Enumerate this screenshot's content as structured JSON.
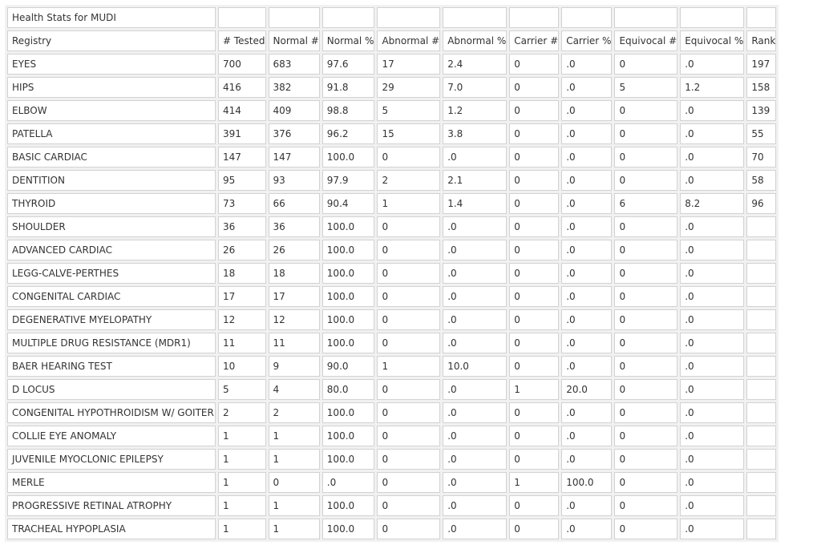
{
  "table": {
    "title": "Health Stats for MUDI",
    "headers": [
      "Registry",
      "# Tested",
      "Normal #",
      "Normal %",
      "Abnormal #",
      "Abnormal %",
      "Carrier #",
      "Carrier %",
      "Equivocal #",
      "Equivocal %",
      "Rank"
    ],
    "rows": [
      [
        "EYES",
        "700",
        "683",
        "97.6",
        "17",
        "2.4",
        "0",
        ".0",
        "0",
        ".0",
        "197"
      ],
      [
        "HIPS",
        "416",
        "382",
        "91.8",
        "29",
        "7.0",
        "0",
        ".0",
        "5",
        "1.2",
        "158"
      ],
      [
        "ELBOW",
        "414",
        "409",
        "98.8",
        "5",
        "1.2",
        "0",
        ".0",
        "0",
        ".0",
        "139"
      ],
      [
        "PATELLA",
        "391",
        "376",
        "96.2",
        "15",
        "3.8",
        "0",
        ".0",
        "0",
        ".0",
        "55"
      ],
      [
        "BASIC CARDIAC",
        "147",
        "147",
        "100.0",
        "0",
        ".0",
        "0",
        ".0",
        "0",
        ".0",
        "70"
      ],
      [
        "DENTITION",
        "95",
        "93",
        "97.9",
        "2",
        "2.1",
        "0",
        ".0",
        "0",
        ".0",
        "58"
      ],
      [
        "THYROID",
        "73",
        "66",
        "90.4",
        "1",
        "1.4",
        "0",
        ".0",
        "6",
        "8.2",
        "96"
      ],
      [
        "SHOULDER",
        "36",
        "36",
        "100.0",
        "0",
        ".0",
        "0",
        ".0",
        "0",
        ".0",
        ""
      ],
      [
        "ADVANCED CARDIAC",
        "26",
        "26",
        "100.0",
        "0",
        ".0",
        "0",
        ".0",
        "0",
        ".0",
        ""
      ],
      [
        "LEGG-CALVE-PERTHES",
        "18",
        "18",
        "100.0",
        "0",
        ".0",
        "0",
        ".0",
        "0",
        ".0",
        ""
      ],
      [
        "CONGENITAL CARDIAC",
        "17",
        "17",
        "100.0",
        "0",
        ".0",
        "0",
        ".0",
        "0",
        ".0",
        ""
      ],
      [
        "DEGENERATIVE MYELOPATHY",
        "12",
        "12",
        "100.0",
        "0",
        ".0",
        "0",
        ".0",
        "0",
        ".0",
        ""
      ],
      [
        "MULTIPLE DRUG RESISTANCE (MDR1)",
        "11",
        "11",
        "100.0",
        "0",
        ".0",
        "0",
        ".0",
        "0",
        ".0",
        ""
      ],
      [
        "BAER HEARING TEST",
        "10",
        "9",
        "90.0",
        "1",
        "10.0",
        "0",
        ".0",
        "0",
        ".0",
        ""
      ],
      [
        "D LOCUS",
        "5",
        "4",
        "80.0",
        "0",
        ".0",
        "1",
        "20.0",
        "0",
        ".0",
        ""
      ],
      [
        "CONGENITAL HYPOTHROIDISM W/ GOITER",
        "2",
        "2",
        "100.0",
        "0",
        ".0",
        "0",
        ".0",
        "0",
        ".0",
        ""
      ],
      [
        "COLLIE EYE ANOMALY",
        "1",
        "1",
        "100.0",
        "0",
        ".0",
        "0",
        ".0",
        "0",
        ".0",
        ""
      ],
      [
        "JUVENILE MYOCLONIC EPILEPSY",
        "1",
        "1",
        "100.0",
        "0",
        ".0",
        "0",
        ".0",
        "0",
        ".0",
        ""
      ],
      [
        "MERLE",
        "1",
        "0",
        ".0",
        "0",
        ".0",
        "1",
        "100.0",
        "0",
        ".0",
        ""
      ],
      [
        "PROGRESSIVE RETINAL ATROPHY",
        "1",
        "1",
        "100.0",
        "0",
        ".0",
        "0",
        ".0",
        "0",
        ".0",
        ""
      ],
      [
        "TRACHEAL HYPOPLASIA",
        "1",
        "1",
        "100.0",
        "0",
        ".0",
        "0",
        ".0",
        "0",
        ".0",
        ""
      ]
    ]
  }
}
